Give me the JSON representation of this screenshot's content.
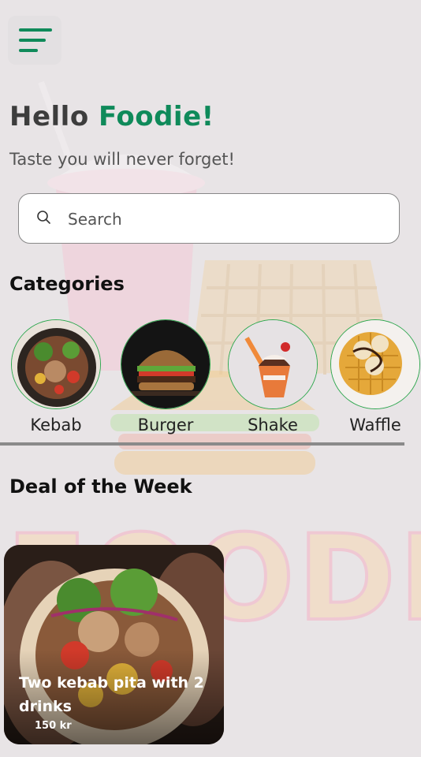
{
  "header": {
    "menu_icon": "hamburger-menu-icon",
    "greeting_prefix": "Hello",
    "greeting_name": "Foodie!",
    "tagline": "Taste you will never forget!"
  },
  "search": {
    "placeholder": "Search",
    "icon": "search-icon"
  },
  "categories": {
    "title": "Categories",
    "items": [
      {
        "label": "Kebab"
      },
      {
        "label": "Burger"
      },
      {
        "label": "Shake"
      },
      {
        "label": "Waffle"
      }
    ]
  },
  "deal": {
    "title": "Deal of the Week",
    "card": {
      "name": "Two kebab pita with 2 drinks",
      "price": "150 kr"
    }
  },
  "background_watermark": "FOODIEZ",
  "colors": {
    "accent": "#0f8a5a",
    "category_border": "#2fa84f",
    "background": "#e8e4e6"
  }
}
